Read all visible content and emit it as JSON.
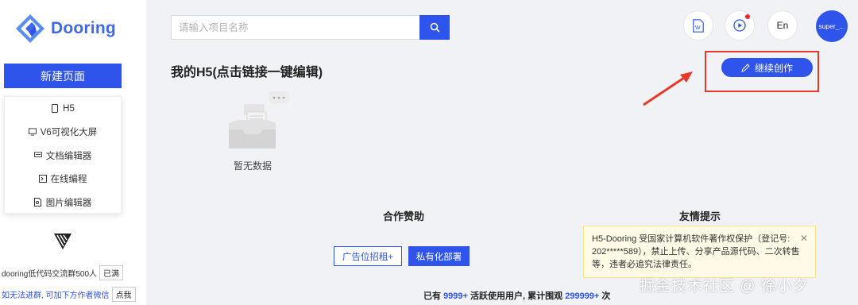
{
  "sidebar": {
    "logo_text": "Dooring",
    "new_page_label": "新建页面",
    "menu": [
      {
        "label": "H5",
        "icon": "mobile-icon"
      },
      {
        "label": "V6可视化大屏",
        "icon": "monitor-icon"
      },
      {
        "label": "文档编辑器",
        "icon": "keyboard-icon"
      },
      {
        "label": "在线编程",
        "icon": "code-icon"
      },
      {
        "label": "图片编辑器",
        "icon": "image-file-icon"
      }
    ],
    "group_text": "dooring低代码交流群500人",
    "group_btn": "已满",
    "wechat_text": "如无法进群, 可加下方作者微信",
    "wechat_btn": "点我"
  },
  "header": {
    "search_placeholder": "请输入项目名称",
    "lang_label": "En",
    "user_name": "super_..."
  },
  "main": {
    "title": "我的H5(点击链接一键编辑)",
    "continue_label": "继续创作",
    "empty_text": "暂无数据",
    "sponsor_title": "合作赞助",
    "friendly_title": "友情提示",
    "ad_btn": "广告位招租+",
    "private_btn": "私有化部署",
    "stats_prefix": "已有",
    "stats_users": "9999+",
    "stats_mid": "活跃使用用户, 累计围观",
    "stats_views": "299999+",
    "stats_suffix": "次"
  },
  "notice": {
    "text": "H5-Dooring 受国家计算机软件著作权保护（登记号: 202*****589），禁止上传、分享产品源代码、二次转售等，违者必追究法律责任。"
  },
  "watermark": "掘金技术社区 @ 徐小夕",
  "colors": {
    "primary": "#2f54eb",
    "highlight": "#e8392b",
    "notice_bg": "#fffbe6"
  }
}
